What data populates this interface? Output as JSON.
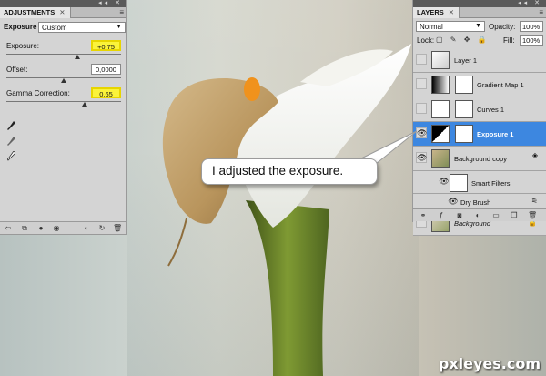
{
  "adjustments_panel": {
    "tab": "ADJUSTMENTS",
    "heading": "Exposure",
    "preset": "Custom",
    "properties": [
      {
        "label": "Exposure:",
        "value": "+0,75",
        "slider_fraction": 0.62
      },
      {
        "label": "Offset:",
        "value": "0,0000",
        "slider_fraction": 0.5
      },
      {
        "label": "Gamma Correction:",
        "value": "0,65",
        "slider_fraction": 0.68
      }
    ]
  },
  "layers_panel": {
    "tab": "LAYERS",
    "blend_mode": "Normal",
    "opacity_label": "Opacity:",
    "opacity": "100%",
    "lock_label": "Lock:",
    "fill_label": "Fill:",
    "fill": "100%",
    "layers": [
      {
        "name": "Layer 1",
        "visible": false
      },
      {
        "name": "Gradient Map 1",
        "visible": false
      },
      {
        "name": "Curves 1",
        "visible": false
      },
      {
        "name": "Exposure 1",
        "visible": true,
        "selected": true
      },
      {
        "name": "Background copy",
        "visible": true
      },
      {
        "name": "Smart Filters",
        "visible": true
      },
      {
        "name": "Dry Brush",
        "visible": true
      },
      {
        "name": "Background",
        "visible": false
      }
    ]
  },
  "callout": {
    "text": "I adjusted the exposure."
  },
  "watermark": "pxleyes.com",
  "colors": {
    "highlight": "#fbf33a",
    "selection": "#3d87e0",
    "panel": "#d4d4d4"
  }
}
